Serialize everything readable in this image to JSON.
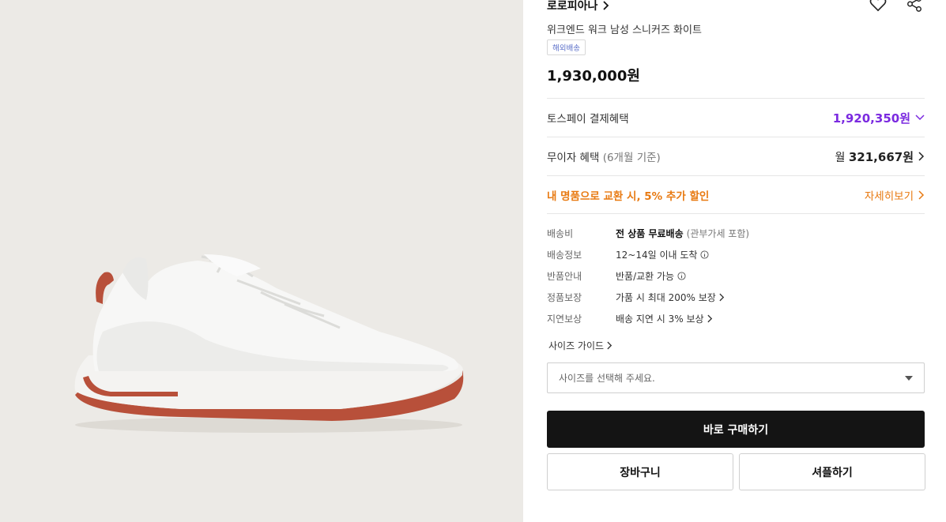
{
  "product": {
    "brand": "로로피아나",
    "title": "위크엔드 워크 남성 스니커즈 화이트",
    "badge": "해외배송",
    "price": "1,930,000원",
    "image_icon": "white-sneaker-image"
  },
  "header_icons": [
    "heart-icon",
    "share-icon"
  ],
  "benefits": {
    "toss": {
      "label": "토스페이 결제혜택",
      "price": "1,920,350원"
    },
    "installment": {
      "label": "무이자 혜택",
      "sub": "(6개월 기준)",
      "prefix": "월",
      "amount": "321,667원"
    },
    "promo": {
      "label": "내 명품으로 교환 시, 5% 추가 할인",
      "link": "자세히보기"
    }
  },
  "shipping": {
    "fee": {
      "key": "배송비",
      "value": "전 상품 무료배송",
      "note": "(관부가세 포함)"
    },
    "info": {
      "key": "배송정보",
      "value": "12~14일 이내 도착"
    },
    "return": {
      "key": "반품안내",
      "value": "반품/교환 가능"
    },
    "authentic": {
      "key": "정품보장",
      "value": "가품 시 최대 200% 보장"
    },
    "delay": {
      "key": "지연보상",
      "value": "배송 지연 시 3% 보상"
    }
  },
  "size": {
    "guide_label": "사이즈 가이드",
    "placeholder": "사이즈를 선택해 주세요."
  },
  "actions": {
    "buy": "바로 구매하기",
    "cart": "장바구니",
    "showroom": "셔플하기"
  },
  "colors": {
    "accent_purple": "#7b2ae0",
    "accent_orange": "#e87a12",
    "buy_button": "#141414",
    "badge_text": "#5a6ec8"
  }
}
